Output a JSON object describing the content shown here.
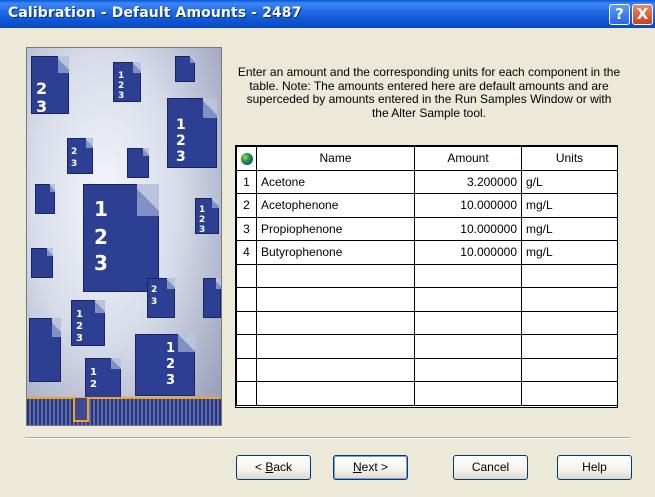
{
  "window": {
    "title": "Calibration - Default Amounts -  2487",
    "help_glyph": "?",
    "close_glyph": "X"
  },
  "instructions": "Enter an amount and the corresponding units for each component in the table.  Note:  The amounts entered here are default amounts and are superceded by amounts entered in the Run Samples Window or with the Alter Sample tool.",
  "table": {
    "corner_icon": "globe-icon",
    "columns": [
      "Name",
      "Amount",
      "Units"
    ],
    "rows": [
      {
        "num": "1",
        "name": "Acetone",
        "amount": "3.200000",
        "units": "g/L"
      },
      {
        "num": "2",
        "name": "Acetophenone",
        "amount": "10.000000",
        "units": "mg/L"
      },
      {
        "num": "3",
        "name": "Propiophenone",
        "amount": "10.000000",
        "units": "mg/L"
      },
      {
        "num": "4",
        "name": "Butyrophenone",
        "amount": "10.000000",
        "units": "mg/L"
      }
    ],
    "empty_rows": 6
  },
  "buttons": {
    "back": {
      "pre": "< ",
      "accel": "B",
      "post": "ack"
    },
    "next": {
      "pre": "",
      "accel": "N",
      "post": "ext >"
    },
    "cancel": "Cancel",
    "help": "Help"
  },
  "colors": {
    "titlebar": "#0a57d6",
    "dialog_bg": "#ece9d8",
    "accent_orange": "#f6a21a",
    "doc_blue": "#2c3f92"
  }
}
